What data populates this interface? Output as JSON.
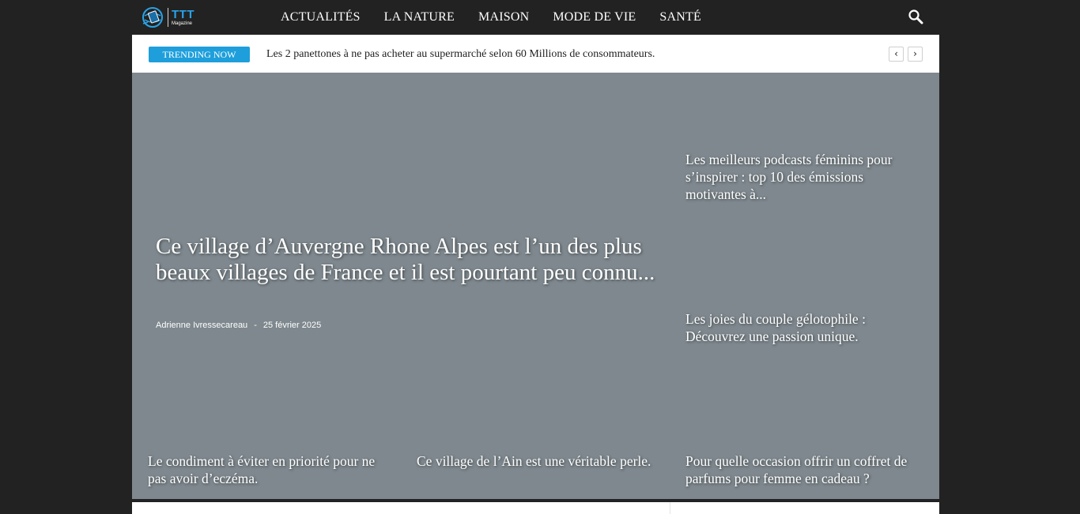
{
  "brand": {
    "name": "TTT",
    "tagline": "Magazine",
    "accent": "#29a3e8"
  },
  "nav": {
    "items": [
      "ACTUALITÉS",
      "LA NATURE",
      "MAISON",
      "MODE DE VIE",
      "SANTÉ"
    ],
    "search_icon": "search-icon"
  },
  "trending": {
    "badge": "TRENDING NOW",
    "headline": "Les 2 panettones à ne pas acheter au supermarché selon 60 Millions de consommateurs.",
    "prev_icon": "‹",
    "next_icon": "›",
    "badge_color": "#1e9fdb"
  },
  "featured": {
    "title": "Ce village d’Auvergne Rhone Alpes est l’un des plus beaux villages de France et il est pourtant peu connu...",
    "author": "Adrienne Ivressecareau",
    "separator": "-",
    "date": "25 février 2025"
  },
  "side_posts": [
    "Les meilleurs podcasts féminins pour s’inspirer : top 10 des émissions motivantes à...",
    "Les joies du couple gélotophile : Découvrez une passion unique."
  ],
  "bottom_posts": [
    "Le condiment à éviter en priorité pour ne pas avoir d’eczéma.",
    "Ce village de l’Ain est une véritable perle.",
    "Pour quelle occasion offrir un coffret de parfums pour femme en cadeau ?"
  ],
  "colors": {
    "topbar": "#222222",
    "hero_bg": "#7e888e"
  }
}
